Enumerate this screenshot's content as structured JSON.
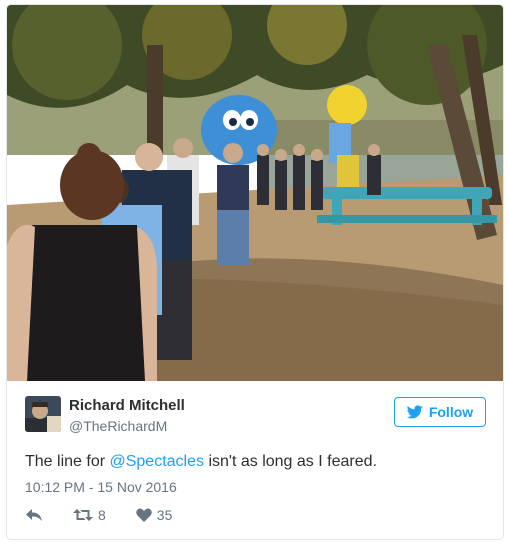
{
  "tweet": {
    "author": {
      "name": "Richard Mitchell",
      "handle": "@TheRichardM",
      "avatar_icon": "profile-photo"
    },
    "follow_label": "Follow",
    "text": {
      "prefix": "The line for ",
      "mention": "@Spectacles",
      "suffix": " isn't as long as I feared."
    },
    "timestamp": "10:12 PM - 15 Nov 2016",
    "actions": {
      "reply_icon": "reply-icon",
      "retweet_icon": "retweet-icon",
      "retweet_count": "8",
      "like_icon": "heart-icon",
      "like_count": "35"
    },
    "photo": {
      "subject": "people lining up outdoors by a lake next to a giant blue sculpture and a yellow figure"
    }
  },
  "colors": {
    "brand_blue": "#1da1f2",
    "text": "#292f33",
    "muted": "#66757f",
    "border": "#e1e8ed"
  }
}
